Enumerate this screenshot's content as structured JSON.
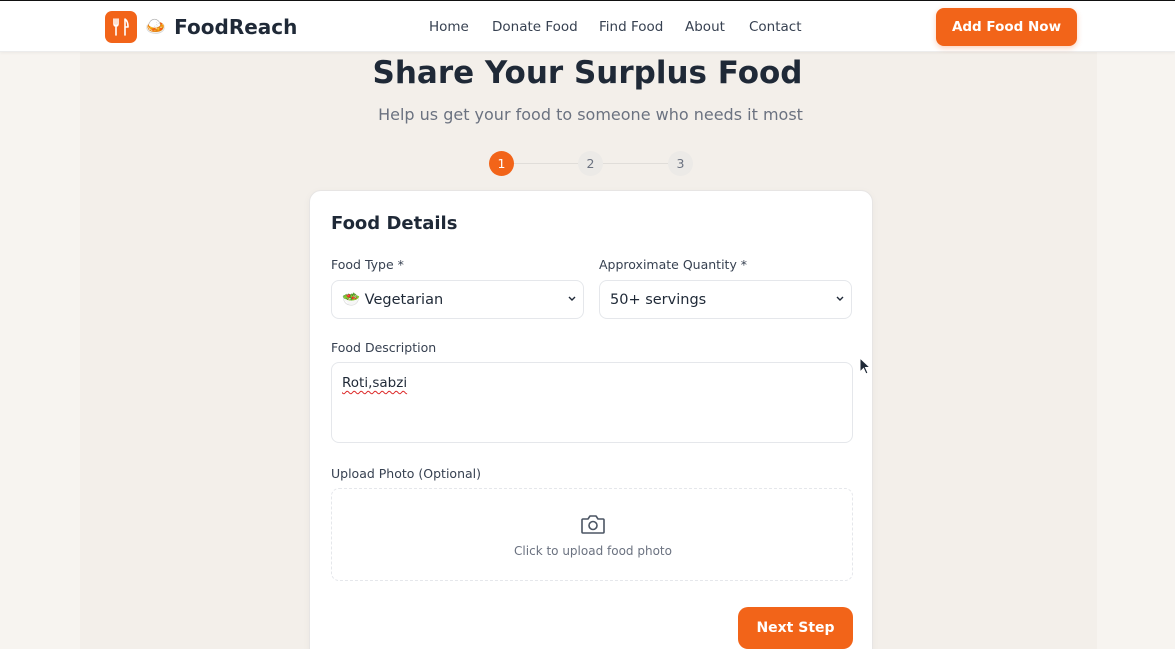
{
  "brand": {
    "name": "FoodReach",
    "logo_icon": "fork-knife-icon",
    "emoji": "🍛"
  },
  "nav": {
    "items": [
      "Home",
      "Donate Food",
      "Find Food",
      "About",
      "Contact"
    ]
  },
  "header": {
    "cta_label": "Add Food Now"
  },
  "hero": {
    "title": "Share Your Surplus Food",
    "subtitle": "Help us get your food to someone who needs it most"
  },
  "steps": {
    "labels": [
      "1",
      "2",
      "3"
    ],
    "active": 1
  },
  "form": {
    "title": "Food Details",
    "food_type": {
      "label": "Food Type *",
      "value": "🥗 Vegetarian"
    },
    "quantity": {
      "label": "Approximate Quantity *",
      "value": "50+ servings"
    },
    "description": {
      "label": "Food Description",
      "value": "Roti,sabzi"
    },
    "upload": {
      "label": "Upload Photo (Optional)",
      "text": "Click to upload food photo",
      "icon": "camera-icon"
    },
    "next_label": "Next Step"
  },
  "colors": {
    "accent": "#f26419",
    "background": "#f3efea",
    "text": "#1f2937",
    "muted": "#6b7280"
  }
}
